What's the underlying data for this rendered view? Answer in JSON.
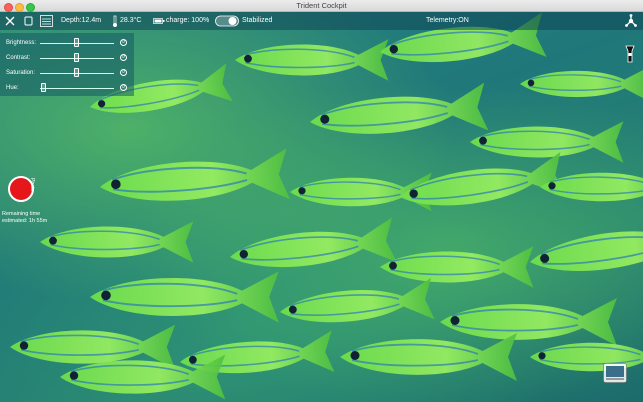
{
  "window": {
    "title": "Trident Cockpit"
  },
  "topbar": {
    "depth": "Depth:12.4m",
    "temperature": "28.3°C",
    "charge": "charge: 100%",
    "stabilized_label": "Stabilized",
    "telemetry": "Telemetry:ON"
  },
  "camera_controls": {
    "brightness": {
      "label": "Brightness:",
      "level": 0.5
    },
    "contrast": {
      "label": "Contrast:",
      "level": 0.5
    },
    "saturation": {
      "label": "Saturation:",
      "level": 0.5
    },
    "hue": {
      "label": "Hue:",
      "level": 0.05
    }
  },
  "recording": {
    "photo_label": "Photo",
    "remaining_line1": "Remaining time",
    "remaining_line2": "estimated: 1h 55m"
  },
  "colors": {
    "record": "#e6171b",
    "overlay": "#0f4655",
    "fish_green": "#8cff3c"
  },
  "icons": {
    "close": "close-icon",
    "square": "square-icon",
    "settings": "sliders-icon",
    "thermometer": "thermometer-icon",
    "battery": "battery-icon",
    "drone": "drone-icon",
    "light": "flashlight-icon",
    "gallery": "gallery-icon"
  }
}
